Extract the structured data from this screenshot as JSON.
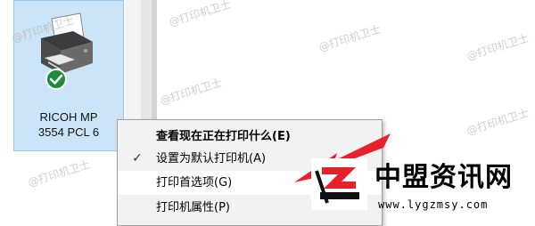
{
  "printer": {
    "name_line1": "RICOH MP",
    "name_line2": "3554 PCL 6",
    "icon": "printer-default-icon"
  },
  "context_menu": {
    "items": [
      {
        "label": "查看现在正在打印什么(E)",
        "bold": true,
        "checked": false,
        "highlighted": false
      },
      {
        "label": "设置为默认打印机(A)",
        "bold": false,
        "checked": true,
        "highlighted": false
      },
      {
        "label": "打印首选项(G)",
        "bold": false,
        "checked": false,
        "highlighted": true
      },
      {
        "label": "打印机属性(P)",
        "bold": false,
        "checked": false,
        "highlighted": false
      }
    ]
  },
  "watermark_text": "@打印机卫士",
  "brand": {
    "name": "中盟资讯网",
    "url": "www.lygzmsy.com"
  },
  "colors": {
    "selection": "#cce4f7",
    "selection_border": "#99c9ef",
    "menu_bg": "#f2f2f2",
    "arrow": "#e8202a",
    "check_green": "#1e8a3c"
  }
}
